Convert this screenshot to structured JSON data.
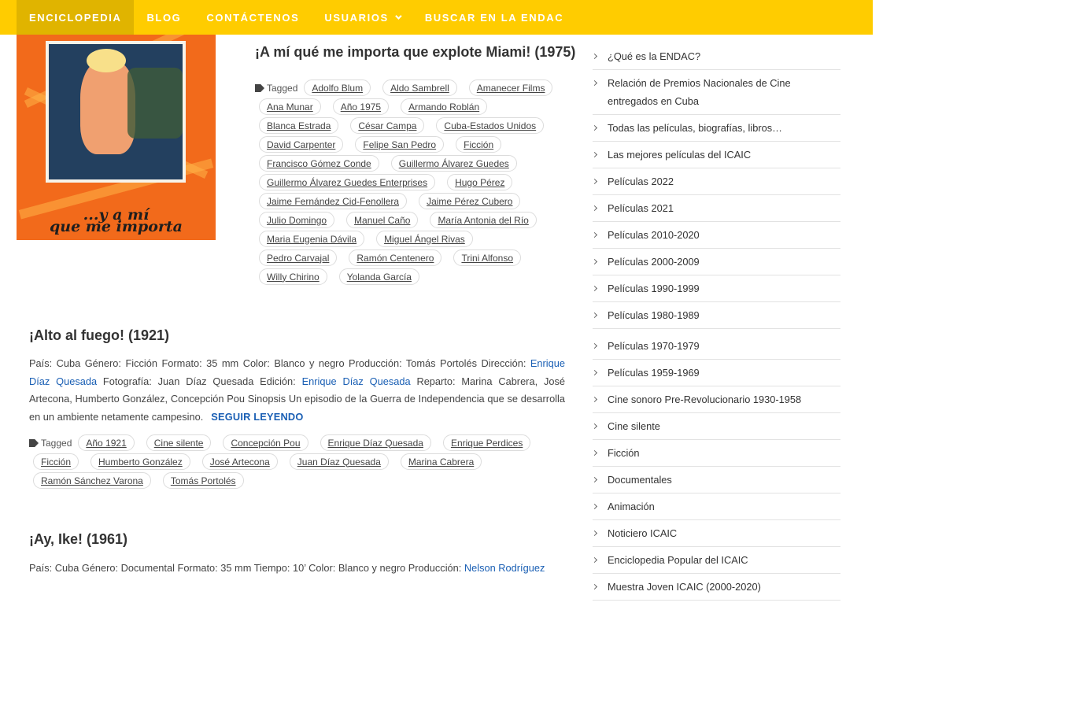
{
  "nav": {
    "items": [
      {
        "label": "ENCICLOPEDIA",
        "active": true
      },
      {
        "label": "BLOG"
      },
      {
        "label": "CONTÁCTENOS"
      },
      {
        "label": "USUARIOS",
        "has_dropdown": true
      },
      {
        "label": "BUSCAR EN LA ENDAC"
      }
    ],
    "bar_color": "#ffcc00",
    "active_color": "#e0b400"
  },
  "poster": {
    "text_line1": "...y a mí",
    "text_line2": "que me importa"
  },
  "post1": {
    "title": "¡A mí qué me importa que explote Miami! (1975)",
    "tagged_label": "Tagged",
    "tags": [
      "Adolfo Blum",
      "Aldo Sambrell",
      "Amanecer Films",
      "Ana Munar",
      "Año 1975",
      "Armando Roblán",
      "Blanca Estrada",
      "César Campa",
      "Cuba-Estados Unidos",
      "David Carpenter",
      "Felipe San Pedro",
      "Ficción",
      "Francisco Gómez Conde",
      "Guillermo Álvarez Guedes",
      "Guillermo Álvarez Guedes Enterprises",
      "Hugo Pérez",
      "Jaime Fernández Cid-Fenollera",
      "Jaime Pérez Cubero",
      "Julio Domingo",
      "Manuel Caño",
      "María Antonia del Río",
      "Maria Eugenia Dávila",
      "Miguel Ángel Rivas",
      "Pedro Carvajal",
      "Ramón Centenero",
      "Trini Alfonso",
      "Willy Chirino",
      "Yolanda García"
    ]
  },
  "post2": {
    "title": "¡Alto al fuego! (1921)",
    "excerpt": {
      "t1": "País: Cuba Género: Ficción Formato: 35 mm Color: Blanco y negro Producción: Tomás Portolés Dirección: ",
      "link1": "Enrique Díaz Quesada",
      "t2": " Fotografía: Juan Díaz Quesada Edición: ",
      "link2": "Enrique Díaz Quesada",
      "t3": " Reparto: Marina Cabrera, José Artecona, Humberto González, Concepción Pou Sinopsis Un episodio de la Guerra de Independencia que se desarrolla en un ambiente netamente campesino.",
      "read_more": "SEGUIR LEYENDO"
    },
    "tagged_label": "Tagged",
    "tags": [
      "Año 1921",
      "Cine silente",
      "Concepción Pou",
      "Enrique Díaz Quesada",
      "Enrique Perdices",
      "Ficción",
      "Humberto González",
      "José Artecona",
      "Juan Díaz Quesada",
      "Marina Cabrera",
      "Ramón Sánchez Varona",
      "Tomás Portolés"
    ]
  },
  "post3": {
    "title": "¡Ay, Ike! (1961)",
    "excerpt": {
      "t1": "País: Cuba Género: Documental Formato: 35 mm Tiempo: 10’ Color: Blanco y negro Producción: ",
      "link1": "Nelson Rodríguez"
    }
  },
  "sidebar": {
    "items": [
      "¿Qué es la ENDAC?",
      "Relación de Premios Nacionales de Cine entregados en Cuba",
      "Todas las películas, biografías, libros…",
      "Las mejores películas del ICAIC",
      "Películas 2022",
      "Películas 2021",
      "Películas 2010-2020",
      "Películas 2000-2009",
      "Películas 1990-1999",
      "Películas 1980-1989",
      "Películas 1970-1979",
      "Películas 1959-1969",
      "Cine sonoro Pre-Revolucionario 1930-1958",
      "Cine silente",
      "Ficción",
      "Documentales",
      "Animación",
      "Noticiero ICAIC",
      "Enciclopedia Popular del ICAIC",
      "Muestra Joven ICAIC (2000-2020)"
    ]
  }
}
